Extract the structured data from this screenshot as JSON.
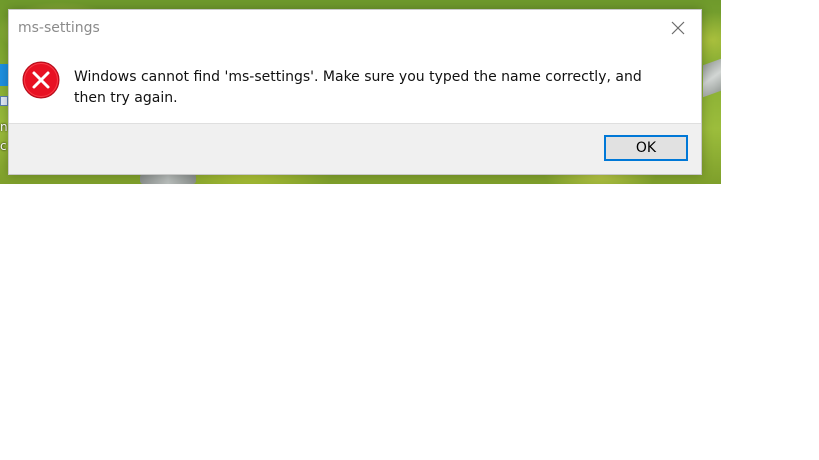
{
  "dialog": {
    "title": "ms-settings",
    "message": "Windows cannot find 'ms-settings'. Make sure you typed the name correctly, and then try again.",
    "ok_label": "OK",
    "icon": "error-icon",
    "close_icon": "close-icon"
  },
  "desktop": {
    "icon_text_1": "n",
    "icon_text_2": "c"
  },
  "colors": {
    "error_red": "#e81123",
    "accent_blue": "#0078d7",
    "footer_bg": "#f0f0f0",
    "title_gray": "#8b8b8b"
  }
}
